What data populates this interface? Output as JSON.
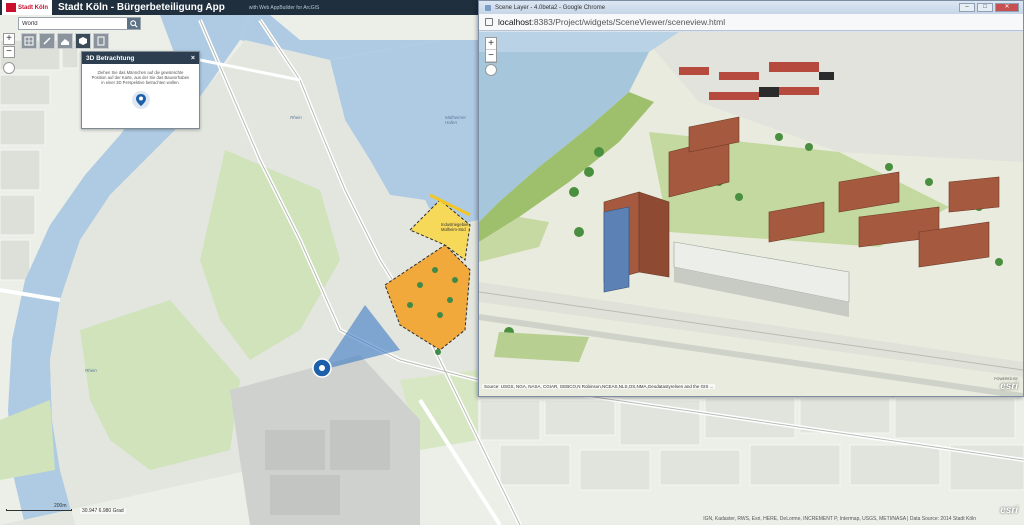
{
  "header": {
    "logo_text": "Stadt Köln",
    "title": "Stadt Köln - Bürgerbeteiligung App",
    "subtitle": "with Web AppBuilder for ArcGIS"
  },
  "search": {
    "value": "World"
  },
  "toolbar": {
    "tools": [
      "layers-icon",
      "edit-icon",
      "measure-icon",
      "cube-icon",
      "print-icon"
    ]
  },
  "panel": {
    "title": "3D Betrachtung",
    "close": "×",
    "description": "Ziehen Sie das Männchen auf die gewünschte Position auf der Karte, aus der Sie das Bauvorhaben in einer 3D Perspektive betrachten wollen."
  },
  "map": {
    "zoom_in": "+",
    "zoom_out": "−",
    "labels": {
      "rhein_1": "Rhein",
      "rhein_2": "Rhein",
      "muelheimer_hafen": "Mülheimer Hafen",
      "industriegebiet": "Industriegebiet Mülheim-Süd"
    },
    "scale_label": "200m",
    "coordinates": "30.947 6.980 Grad",
    "attribution": "IGN, Kadaster, RWS, Esri, HERE, DeLorme, INCREMENT P, Intermap, USGS, METI/NASA | Data Source: 2014 Stadt Köln",
    "esri_logo": "esri"
  },
  "chrome": {
    "title": "Scene Layer - 4.0beta2 - Google Chrome",
    "url_host": "localhost",
    "url_path": ":8383/Project/widgets/SceneViewer/sceneview.html",
    "minimize": "–",
    "maximize": "□",
    "close": "✕"
  },
  "scene": {
    "zoom_in": "+",
    "zoom_out": "−",
    "attribution": "Source: USGS, NGA, NASA, CGIAR, GEBCO,N Robinson,NCEAS,NLS,OS,NMA,Geodatastyrelsen and the GIS ...",
    "powered": "POWERED BY",
    "esri_logo": "esri"
  },
  "colors": {
    "header_bg": "#1f2f3d",
    "water": "#a9c8e0",
    "park": "#cfe3b9",
    "project_area": "#f2a93b",
    "brick": "#a55a3f"
  }
}
